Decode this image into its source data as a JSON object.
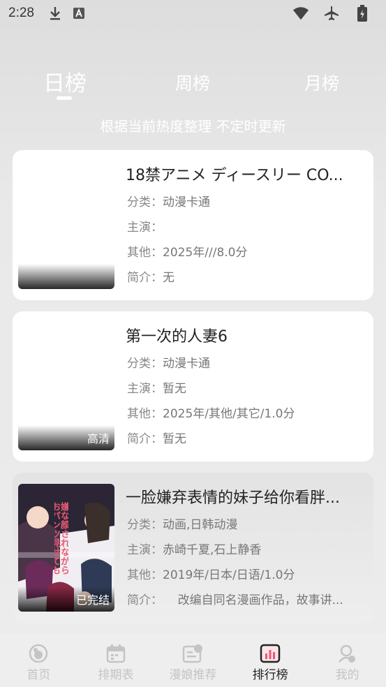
{
  "status_bar": {
    "time": "2:28",
    "icons": [
      "download-icon",
      "a-notification-icon",
      "wifi-icon",
      "airplane-icon",
      "battery-icon"
    ]
  },
  "tabs": [
    {
      "label": "日榜",
      "active": true
    },
    {
      "label": "周榜",
      "active": false
    },
    {
      "label": "月榜",
      "active": false
    }
  ],
  "subtitle": "根据当前热度整理 不定时更新",
  "labels": {
    "category": "分类：",
    "cast": "主演：",
    "other": "其他：",
    "intro": "简介："
  },
  "items": [
    {
      "title": "18禁アニメ ディースリー CO...",
      "category": "动漫卡通",
      "cast": "",
      "other": "2025年///8.0分",
      "intro": "无",
      "badge": ""
    },
    {
      "title": "第一次的人妻6",
      "category": "动漫卡通",
      "cast": "暂无",
      "other": "2025年/其他/其它/1.0分",
      "intro": "暂无",
      "badge": "高清"
    },
    {
      "title": "一脸嫌弃表情的妹子给你看胖...",
      "category": "动画,日韩动漫",
      "cast": "赤崎千夏,石上静香",
      "other": "2019年/日本/日语/1.0分",
      "intro": "    改编自同名漫画作品，故事讲...",
      "badge": "已完结",
      "poster_text": "嫌な顔されながらおパンツ見せてもらいたい2"
    }
  ],
  "bottom_nav": [
    {
      "label": "首页",
      "icon": "home-icon",
      "active": false
    },
    {
      "label": "排期表",
      "icon": "calendar-icon",
      "active": false
    },
    {
      "label": "漫娘推荐",
      "icon": "recommend-icon",
      "active": false
    },
    {
      "label": "排行榜",
      "icon": "ranking-icon",
      "active": true
    },
    {
      "label": "我的",
      "icon": "profile-icon",
      "active": false
    }
  ],
  "colors": {
    "active_nav": "#222222",
    "inactive_nav": "#c4c4c4",
    "accent": "#e85a74"
  }
}
